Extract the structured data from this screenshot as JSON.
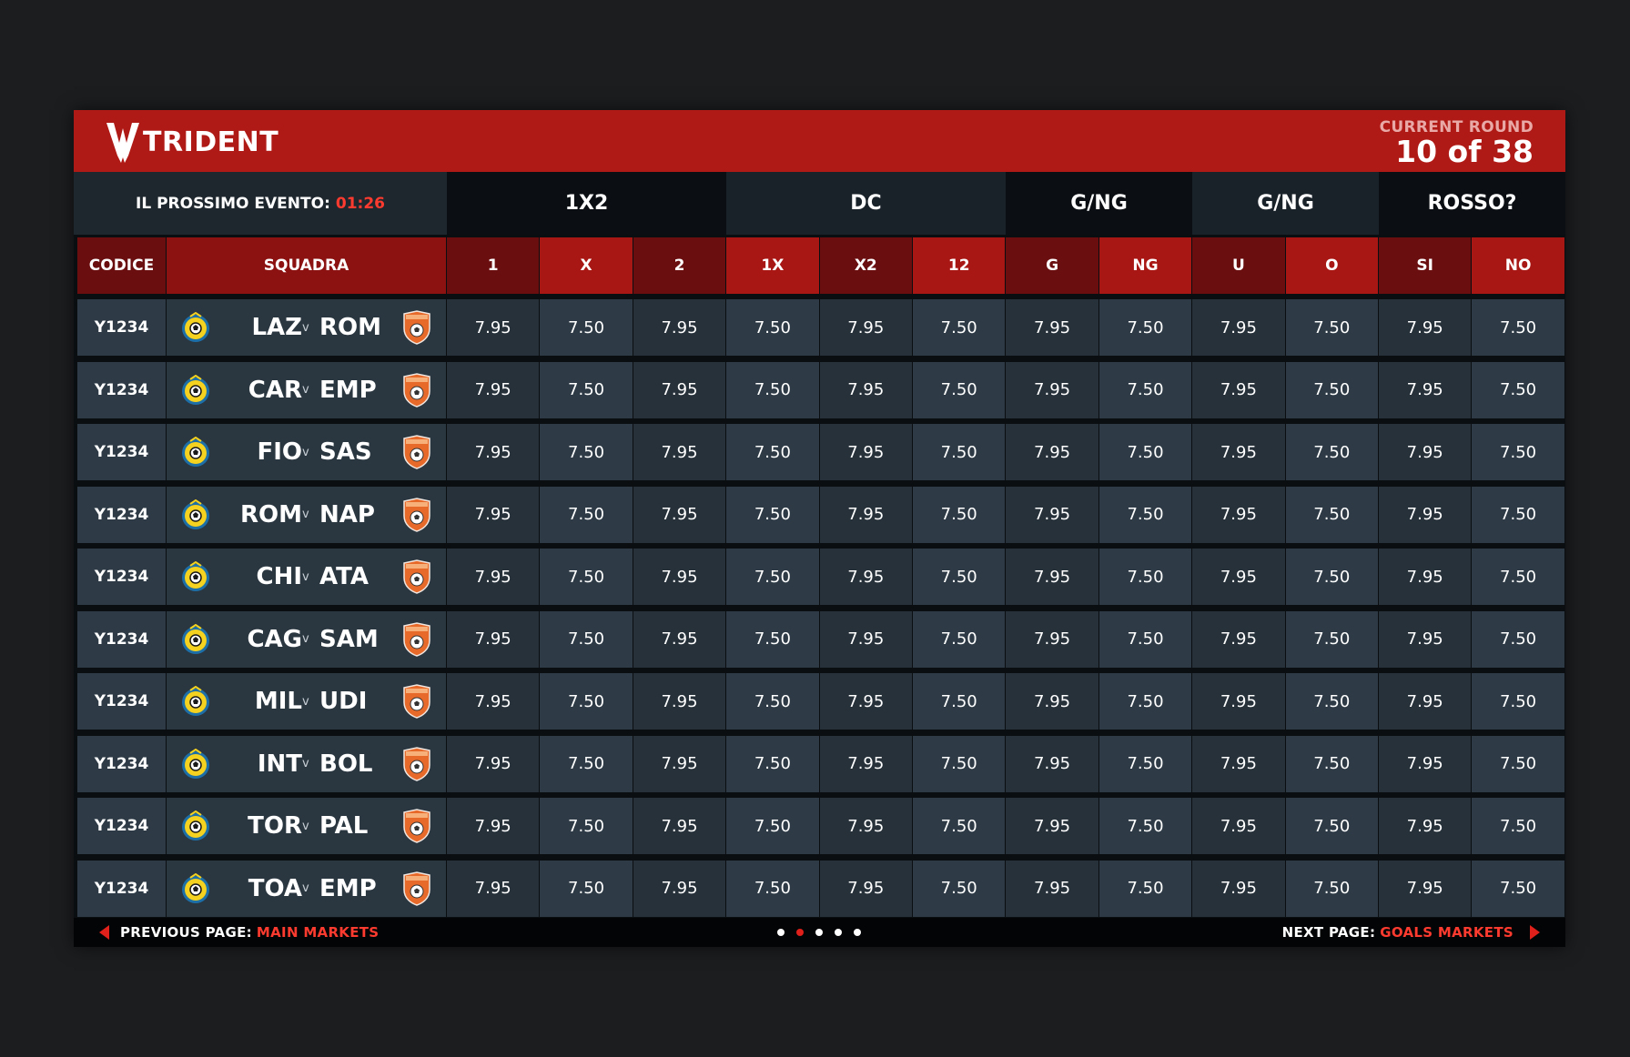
{
  "brand": {
    "name": "TRIDENT",
    "logo_icon": "trident-logo-icon"
  },
  "round": {
    "label": "CURRENT ROUND",
    "value": "10 of 38"
  },
  "next_event": {
    "label": "IL PROSSIMO EVENTO:",
    "timer": "01:26"
  },
  "groups": [
    "1X2",
    "DC",
    "G/NG",
    "G/NG",
    "ROSSO?"
  ],
  "columns": {
    "code": "CODICE",
    "team": "SQUADRA",
    "odds": [
      "1",
      "X",
      "2",
      "1X",
      "X2",
      "12",
      "G",
      "NG",
      "U",
      "O",
      "SI",
      "NO"
    ]
  },
  "rows": [
    {
      "code": "Y1234",
      "home": "LAZ",
      "vs": "v",
      "away": "ROM",
      "odds": [
        "7.95",
        "7.50",
        "7.95",
        "7.50",
        "7.95",
        "7.50",
        "7.95",
        "7.50",
        "7.95",
        "7.50",
        "7.95",
        "7.50"
      ]
    },
    {
      "code": "Y1234",
      "home": "CAR",
      "vs": "v",
      "away": "EMP",
      "odds": [
        "7.95",
        "7.50",
        "7.95",
        "7.50",
        "7.95",
        "7.50",
        "7.95",
        "7.50",
        "7.95",
        "7.50",
        "7.95",
        "7.50"
      ]
    },
    {
      "code": "Y1234",
      "home": "FIO",
      "vs": "v",
      "away": "SAS",
      "odds": [
        "7.95",
        "7.50",
        "7.95",
        "7.50",
        "7.95",
        "7.50",
        "7.95",
        "7.50",
        "7.95",
        "7.50",
        "7.95",
        "7.50"
      ]
    },
    {
      "code": "Y1234",
      "home": "ROM",
      "vs": "v",
      "away": "NAP",
      "odds": [
        "7.95",
        "7.50",
        "7.95",
        "7.50",
        "7.95",
        "7.50",
        "7.95",
        "7.50",
        "7.95",
        "7.50",
        "7.95",
        "7.50"
      ]
    },
    {
      "code": "Y1234",
      "home": "CHI",
      "vs": "v",
      "away": "ATA",
      "odds": [
        "7.95",
        "7.50",
        "7.95",
        "7.50",
        "7.95",
        "7.50",
        "7.95",
        "7.50",
        "7.95",
        "7.50",
        "7.95",
        "7.50"
      ]
    },
    {
      "code": "Y1234",
      "home": "CAG",
      "vs": "v",
      "away": "SAM",
      "odds": [
        "7.95",
        "7.50",
        "7.95",
        "7.50",
        "7.95",
        "7.50",
        "7.95",
        "7.50",
        "7.95",
        "7.50",
        "7.95",
        "7.50"
      ]
    },
    {
      "code": "Y1234",
      "home": "MIL",
      "vs": "v",
      "away": "UDI",
      "odds": [
        "7.95",
        "7.50",
        "7.95",
        "7.50",
        "7.95",
        "7.50",
        "7.95",
        "7.50",
        "7.95",
        "7.50",
        "7.95",
        "7.50"
      ]
    },
    {
      "code": "Y1234",
      "home": "INT",
      "vs": "v",
      "away": "BOL",
      "odds": [
        "7.95",
        "7.50",
        "7.95",
        "7.50",
        "7.95",
        "7.50",
        "7.95",
        "7.50",
        "7.95",
        "7.50",
        "7.95",
        "7.50"
      ]
    },
    {
      "code": "Y1234",
      "home": "TOR",
      "vs": "v",
      "away": "PAL",
      "odds": [
        "7.95",
        "7.50",
        "7.95",
        "7.50",
        "7.95",
        "7.50",
        "7.95",
        "7.50",
        "7.95",
        "7.50",
        "7.95",
        "7.50"
      ]
    },
    {
      "code": "Y1234",
      "home": "TOA",
      "vs": "v",
      "away": "EMP",
      "odds": [
        "7.95",
        "7.50",
        "7.95",
        "7.50",
        "7.95",
        "7.50",
        "7.95",
        "7.50",
        "7.95",
        "7.50",
        "7.95",
        "7.50"
      ]
    }
  ],
  "icons": {
    "home_team": "yellow-football-crest-icon",
    "away_team": "orange-football-shield-icon"
  },
  "footer": {
    "prev_label": "PREVIOUS PAGE:",
    "prev_link": "MAIN MARKETS",
    "next_label": "NEXT PAGE:",
    "next_link": "GOALS MARKETS",
    "page_count": 5,
    "current_page": 2
  },
  "colors": {
    "accent": "#b01a16",
    "timer": "#ff3b2f",
    "background": "#1c1d1f"
  }
}
